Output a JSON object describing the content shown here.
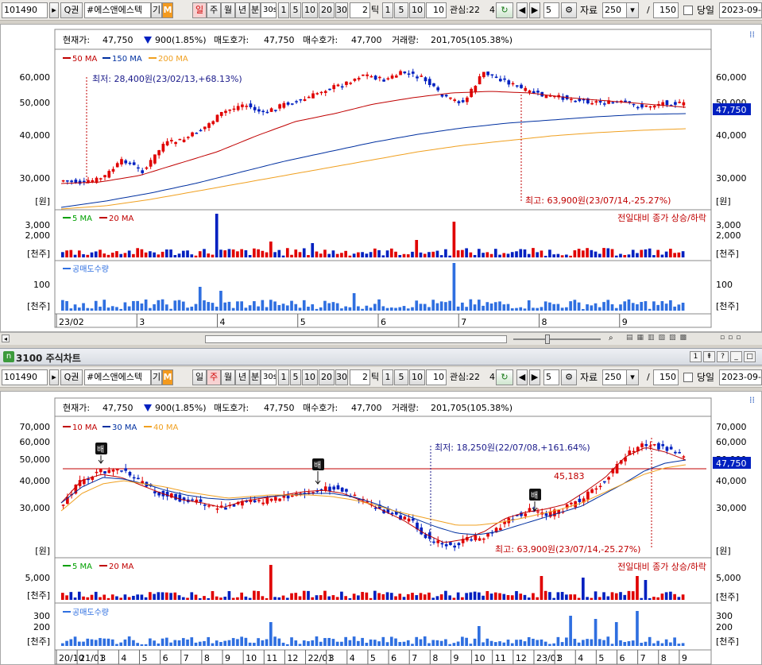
{
  "toolbar": {
    "code": "101490",
    "search_label": "Q권",
    "stock_name": "#에스앤에스텍",
    "gi": "기",
    "m_badge": "M",
    "periods": [
      "일",
      "주",
      "월",
      "년",
      "분"
    ],
    "minute_value": "30s",
    "quick": [
      "1",
      "5",
      "10",
      "20",
      "30"
    ],
    "tick_value": "2",
    "tick_label": "틱",
    "quick2": [
      "1",
      "5",
      "10"
    ],
    "watch_label": "관심:22",
    "watch_dd": "4",
    "count_value": "5",
    "data_label": "자료",
    "data_value": "250",
    "slash": "/",
    "range_value": "150",
    "same_day_label": "당일",
    "date_value": "2023-09-1",
    "date_value_bottom": "2023-09-"
  },
  "top": {
    "quote": {
      "price_label": "현재가:",
      "price": "47,750",
      "change": "900(1.85%)",
      "ask_label": "매도호가:",
      "ask": "47,750",
      "bid_label": "매수호가:",
      "bid": "47,700",
      "vol_label": "거래량:",
      "vol": "201,705(105.38%)"
    },
    "legend": [
      {
        "label": "50 MA",
        "color": "#c00000"
      },
      {
        "label": "150 MA",
        "color": "#0030a0"
      },
      {
        "label": "200 MA",
        "color": "#f0a020"
      }
    ],
    "y_ticks": [
      "60,000",
      "50,000",
      "40,000",
      "30,000"
    ],
    "unit_won": "[원]",
    "price_box": "47,750",
    "low_note": "최저: 28,400원(23/02/13,+68.13%)",
    "high_note": "최고: 63,900원(23/07/14,-25.27%)",
    "vol_legend": [
      {
        "label": "5 MA",
        "color": "#00a000"
      },
      {
        "label": "20 MA",
        "color": "#c00000"
      }
    ],
    "vol_note": "전일대비 종가 상승/하락",
    "vol_ticks": [
      "3,000",
      "2,000"
    ],
    "unit_thousand": "[천주]",
    "short_label": "공매도수량",
    "short_ticks": [
      "100"
    ],
    "x_labels": [
      "23/02",
      "3",
      "4",
      "5",
      "6",
      "7",
      "8",
      "9"
    ]
  },
  "bottom": {
    "window_title": "3100 주식차트",
    "quote": {
      "price_label": "현재가:",
      "price": "47,750",
      "change": "900(1.85%)",
      "ask_label": "매도호가:",
      "ask": "47,750",
      "bid_label": "매수호가:",
      "bid": "47,700",
      "vol_label": "거래량:",
      "vol": "201,705(105.38%)"
    },
    "legend": [
      {
        "label": "10 MA",
        "color": "#c00000"
      },
      {
        "label": "30 MA",
        "color": "#0030a0"
      },
      {
        "label": "40 MA",
        "color": "#f0a020"
      }
    ],
    "y_ticks": [
      "70,000",
      "60,000",
      "50,000",
      "40,000",
      "30,000"
    ],
    "unit_won": "[원]",
    "price_box": "47,750",
    "line_value": "45,183",
    "bae": "배",
    "low_note": "최저: 18,250원(22/07/08,+161.64%)",
    "high_note": "최고: 63,900원(23/07/14,-25.27%)",
    "vol_legend": [
      {
        "label": "5 MA",
        "color": "#00a000"
      },
      {
        "label": "20 MA",
        "color": "#c00000"
      }
    ],
    "vol_note": "전일대비 종가 상승/하락",
    "vol_ticks": [
      "5,000"
    ],
    "unit_thousand": "[천주]",
    "short_label": "공매도수량",
    "short_ticks": [
      "300",
      "200"
    ],
    "x_labels": [
      "20/10",
      "21/01",
      "3",
      "4",
      "5",
      "6",
      "7",
      "8",
      "9",
      "10",
      "11",
      "12",
      "22/01",
      "3",
      "4",
      "5",
      "6",
      "7",
      "8",
      "9",
      "10",
      "11",
      "12",
      "23/01",
      "3",
      "4",
      "5",
      "6",
      "7",
      "8",
      "9"
    ]
  },
  "colors": {
    "up": "#e00000",
    "down": "#0020c0",
    "ma_red": "#c00000",
    "ma_blue": "#0030a0",
    "ma_orange": "#f0a020",
    "short_bar": "#2f6fe0"
  }
}
